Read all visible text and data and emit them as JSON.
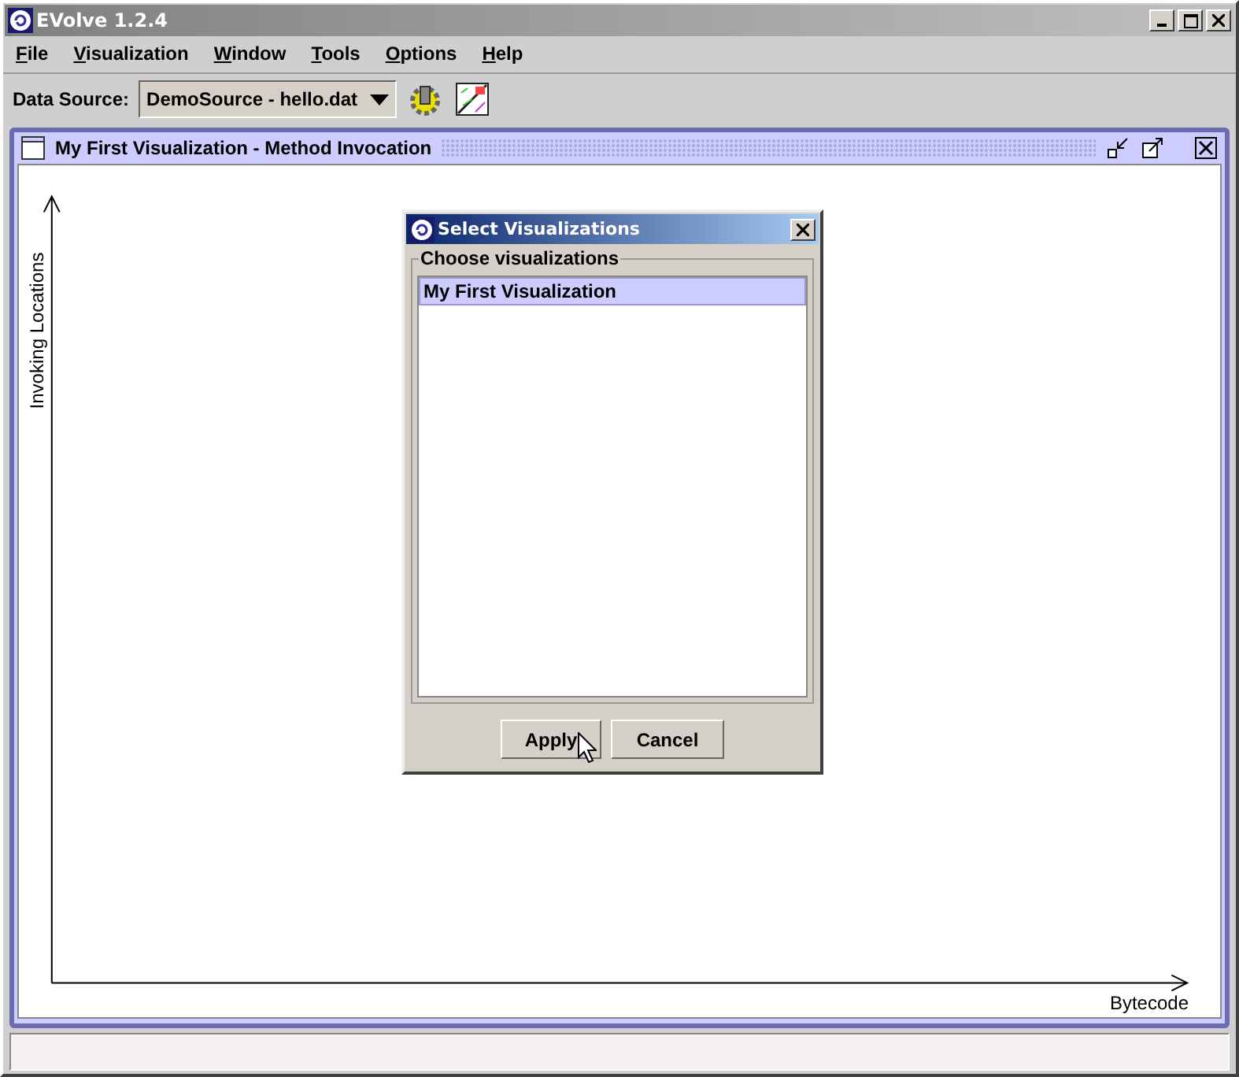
{
  "window": {
    "title": "EVolve 1.2.4"
  },
  "menu": [
    "File",
    "Visualization",
    "Window",
    "Tools",
    "Options",
    "Help"
  ],
  "toolbar": {
    "label": "Data Source:",
    "source": "DemoSource - hello.dat"
  },
  "frame": {
    "title": "My First Visualization - Method Invocation",
    "y_axis": "Invoking Locations",
    "x_axis": "Bytecode"
  },
  "dialog": {
    "title": "Select Visualizations",
    "group": "Choose visualizations",
    "items": [
      {
        "label": "My First Visualization",
        "selected": true
      }
    ],
    "buttons": [
      "Apply",
      "Cancel"
    ]
  }
}
